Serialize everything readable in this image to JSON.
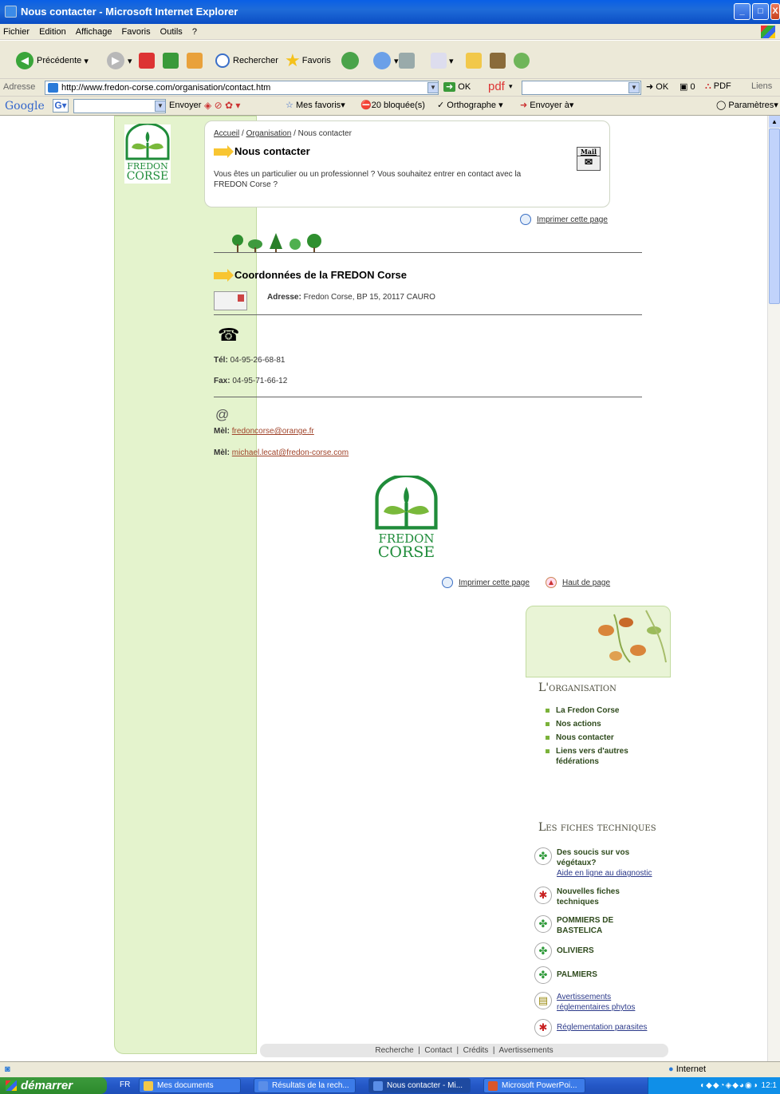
{
  "window": {
    "title": "Nous contacter - Microsoft Internet Explorer",
    "controls": [
      "_",
      "□",
      "X"
    ]
  },
  "menu": [
    "Fichier",
    "Edition",
    "Affichage",
    "Favoris",
    "Outils",
    "?"
  ],
  "toolbar": {
    "back": "Précédente",
    "search": "Rechercher",
    "favorites": "Favoris"
  },
  "address": {
    "label": "Adresse",
    "url": "http://www.fredon-corse.com/organisation/contact.htm",
    "go": "OK",
    "pdf": "pdf",
    "ok2": "OK",
    "count": "0",
    "pdf_btn": "PDF",
    "links": "Liens"
  },
  "google": {
    "logo": "Google",
    "send": "Envoyer",
    "my_favorites": "Mes favoris",
    "blocked": "20 bloquée(s)",
    "spelling": "Orthographe",
    "send_to": "Envoyer à",
    "settings": "Paramètres"
  },
  "page": {
    "logo_text": [
      "FREDON",
      "CORSE"
    ],
    "breadcrumb": {
      "home": "Accueil",
      "sep": " / ",
      "org": "Organisation",
      "current": "Nous contacter"
    },
    "title": "Nous contacter",
    "mail_icon": "Mail",
    "intro": "Vous êtes un particulier ou un professionnel ? Vous souhaitez entrer en contact avec la FREDON Corse ?",
    "print": "Imprimer cette page",
    "section_title": "Coordonnées de la FREDON Corse",
    "address_label": "Adresse:",
    "address_value": "Fredon Corse, BP 15, 20117 CAURO",
    "tel_label": "Tél:",
    "tel_value": "04-95-26-68-81",
    "fax_label": "Fax:",
    "fax_value": "04-95-71-66-12",
    "mel1_label": "Mèl:",
    "mel1_value": "fredoncorse@orange.fr",
    "mel2_label": "Mèl:",
    "mel2_value": "michael.lecat@fredon-corse.com",
    "print2": "Imprimer cette page",
    "top": "Haut de page"
  },
  "sidebar": {
    "org_title": "L'organisation",
    "org_items": [
      "La Fredon Corse",
      "Nos actions",
      "Nous contacter",
      "Liens vers d'autres",
      "fédérations"
    ],
    "fiches_title": "Les fiches techniques",
    "fiches": [
      {
        "l1": "Des soucis sur vos",
        "l2": "végétaux?",
        "sub": "Aide en ligne au diagnostic"
      },
      {
        "l1": "Nouvelles fiches",
        "l2": "techniques"
      },
      {
        "l1": "POMMIERS DE",
        "l2": "BASTELICA"
      },
      {
        "l1": "OLIVIERS"
      },
      {
        "l1": "PALMIERS"
      },
      {
        "l1": "Avertissements",
        "l2": "réglementaires phytos"
      },
      {
        "l1": "Réglementation parasites"
      }
    ]
  },
  "footer": [
    "Recherche",
    "Contact",
    "Crédits",
    "Avertissements"
  ],
  "status": {
    "zone": "Internet"
  },
  "taskbar": {
    "start": "démarrer",
    "lang": "FR",
    "tasks": [
      "Mes documents",
      "Résultats de la rech...",
      "Nous contacter - Mi...",
      "Microsoft PowerPoi..."
    ],
    "clock": "12:1"
  }
}
